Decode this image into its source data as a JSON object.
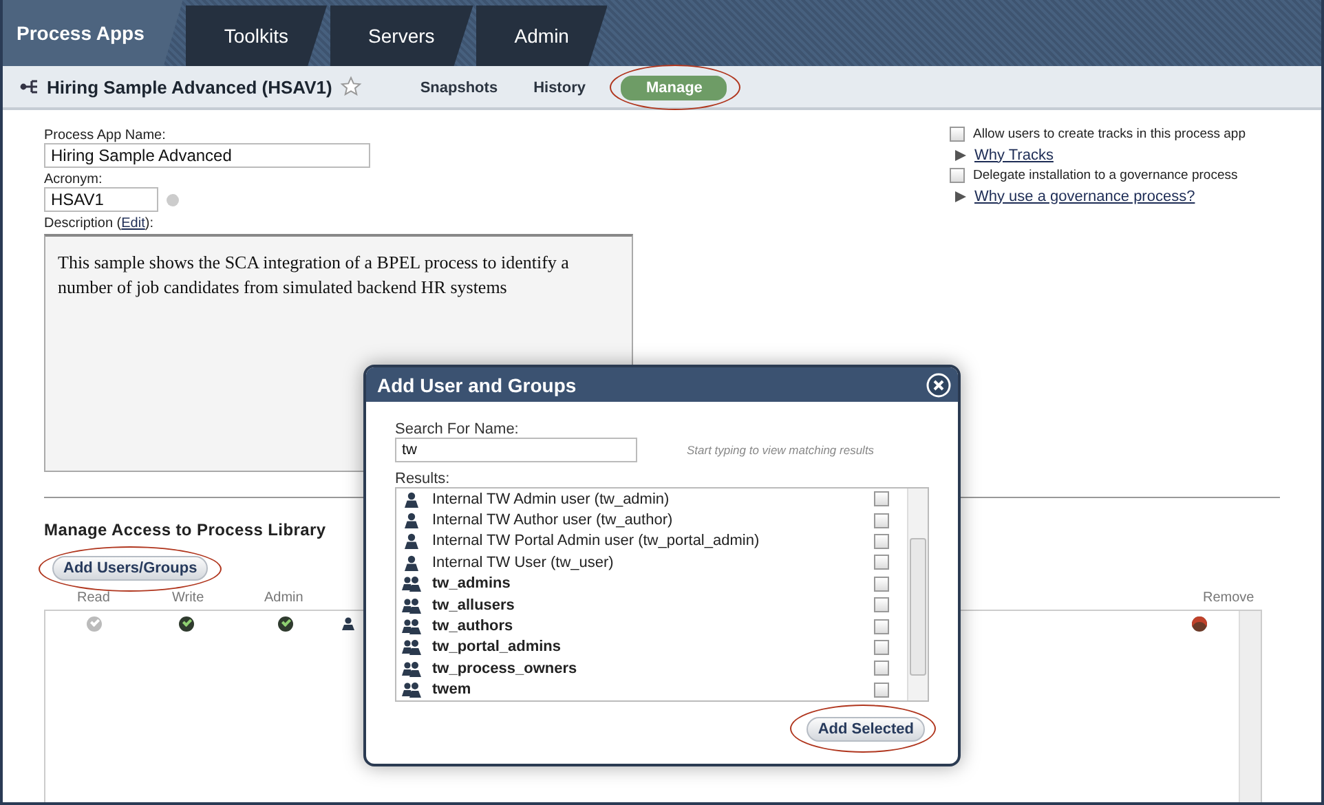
{
  "nav_tabs": [
    {
      "label": "Process Apps",
      "selected": true
    },
    {
      "label": "Toolkits",
      "selected": false
    },
    {
      "label": "Servers",
      "selected": false
    },
    {
      "label": "Admin",
      "selected": false
    }
  ],
  "app_bar": {
    "title": "Hiring Sample Advanced (HSAV1)",
    "favorite": false,
    "links": [
      {
        "label": "Snapshots",
        "selected": false,
        "highlighted": false
      },
      {
        "label": "History",
        "selected": false,
        "highlighted": false
      },
      {
        "label": "Manage",
        "selected": true,
        "highlighted": true
      }
    ]
  },
  "form": {
    "name_label": "Process App Name:",
    "name_value": "Hiring Sample Advanced",
    "acronym_label": "Acronym:",
    "acronym_value": "HSAV1",
    "description_label": "Description (",
    "description_link": "Edit",
    "description_label_end": "):",
    "description": "This sample shows the SCA integration of a BPEL process to identify a number of job candidates from simulated backend HR systems"
  },
  "options": [
    {
      "label": "Allow  users to create tracks in this process app",
      "checked": false,
      "link": "Why Tracks"
    },
    {
      "label": "Delegate installation to a governance process",
      "checked": false,
      "link": "Why use a governance process?"
    }
  ],
  "access": {
    "title": "Manage Access to Process Library",
    "add_button": {
      "label": "Add Users/Groups",
      "highlighted": true
    },
    "columns": [
      "Read",
      "Write",
      "Admin",
      "Remove"
    ],
    "rows": [
      {
        "read": false,
        "write": true,
        "admin": true
      }
    ]
  },
  "dialog": {
    "title": "Add User and Groups",
    "search_label": "Search For Name:",
    "search_value": "tw",
    "hint": "Start typing to view matching results",
    "results_label": "Results:",
    "results": [
      {
        "kind": "user",
        "name": "Internal TW Admin user (tw_admin)",
        "checked": false
      },
      {
        "kind": "user",
        "name": "Internal TW Author user (tw_author)",
        "checked": false
      },
      {
        "kind": "user",
        "name": "Internal TW Portal Admin user (tw_portal_admin)",
        "checked": false
      },
      {
        "kind": "user",
        "name": "Internal TW User (tw_user)",
        "checked": false
      },
      {
        "kind": "group",
        "name": "tw_admins",
        "checked": false
      },
      {
        "kind": "group",
        "name": "tw_allusers",
        "checked": false
      },
      {
        "kind": "group",
        "name": "tw_authors",
        "checked": false
      },
      {
        "kind": "group",
        "name": "tw_portal_admins",
        "checked": false
      },
      {
        "kind": "group",
        "name": "tw_process_owners",
        "checked": false
      },
      {
        "kind": "group",
        "name": "twem",
        "checked": false
      }
    ],
    "add_button": {
      "label": "Add Selected",
      "highlighted": true
    }
  }
}
